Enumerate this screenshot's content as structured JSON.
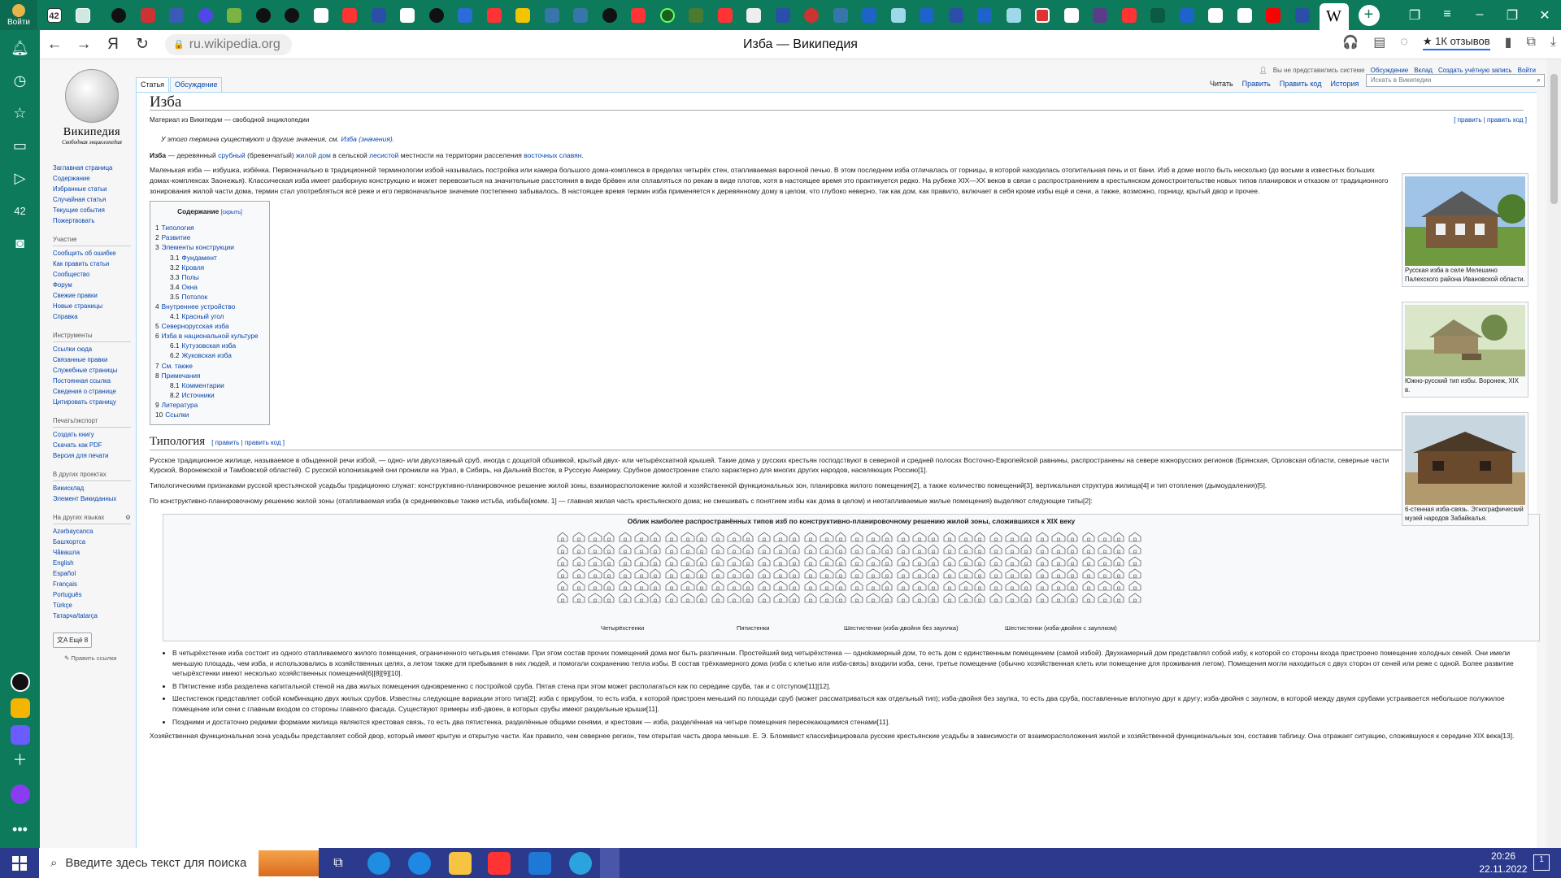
{
  "browser": {
    "login_label": "Войти",
    "tab_badge": "42",
    "wiki_tab_glyph": "W",
    "url": "ru.wikipedia.org",
    "page_title": "Изба — Википедия",
    "reviews": "★ 1К отзывов"
  },
  "wiki": {
    "logo_name": "Википедия",
    "logo_sub": "Свободная энциклопедия",
    "personal": [
      "Вы не представились системе",
      "Обсуждение",
      "Вклад",
      "Создать учётную запись",
      "Войти"
    ],
    "tabs_left": [
      "Статья",
      "Обсуждение"
    ],
    "tabs_right": [
      "Читать",
      "Править",
      "Править код",
      "История"
    ],
    "search_placeholder": "Искать в Википедии",
    "nav_main": [
      "Заглавная страница",
      "Содержание",
      "Избранные статьи",
      "Случайная статья",
      "Текущие события",
      "Пожертвовать"
    ],
    "nav_part_title": "Участие",
    "nav_part": [
      "Сообщить об ошибке",
      "Как править статьи",
      "Сообщество",
      "Форум",
      "Свежие правки",
      "Новые страницы",
      "Справка"
    ],
    "nav_tools_title": "Инструменты",
    "nav_tools": [
      "Ссылки сюда",
      "Связанные правки",
      "Служебные страницы",
      "Постоянная ссылка",
      "Сведения о странице",
      "Цитировать страницу"
    ],
    "nav_print_title": "Печать/экспорт",
    "nav_print": [
      "Создать книгу",
      "Скачать как PDF",
      "Версия для печати"
    ],
    "nav_proj_title": "В других проектах",
    "nav_proj": [
      "Викисклад",
      "Элемент Викиданных"
    ],
    "nav_lang_title": "На других языках",
    "nav_lang": [
      "Azərbaycanca",
      "Башҡортса",
      "Чӑвашла",
      "English",
      "Español",
      "Français",
      "Português",
      "Türkçe",
      "Татарча/tatarça"
    ],
    "more_langs": "文A Ещё 8",
    "edit_links": "✎ Править ссылки"
  },
  "article": {
    "title": "Изба",
    "subtitle": "Материал из Википедии — свободной энциклопедии",
    "edit_links": "[ править | править код ]",
    "hatnote_a": "У этого термина существуют и другие значения, см. ",
    "hatnote_link": "Изба (значения)",
    "lead1_a": "Изба",
    "lead1_b": " — деревянный ",
    "lead1_l1": "срубный",
    "lead1_c": " (бревенчатый) ",
    "lead1_l2": "жилой дом",
    "lead1_d": " в сельской ",
    "lead1_l3": "лесистой",
    "lead1_e": " местности на территории расселения ",
    "lead1_l4": "восточных славян",
    "lead2": "Маленькая изба — избушка, избёнка. Первоначально в традиционной терминологии избой называлась постройка или камера большого дома-комплекса в пределах четырёх стен, отапливаемая варочной печью. В этом последнем изба отличалась от горницы, в которой находилась отопительная печь и от бани. Изб в доме могло быть несколько (до восьми в известных больших домах-комплексах Заонежья). Классическая изба имеет разборную конструкцию и может перевозиться на значительные расстояния в виде брёвен или сплавляться по рекам в виде плотов, хотя в настоящее время это практикуется редко. На рубеже XIX—XX веков в связи с распространением в крестьянском домостроительстве новых типов планировок и отказом от традиционного зонирования жилой части дома, термин стал употребляться всё реже и его первоначальное значение постепенно забывалось. В настоящее время термин изба применяется к деревянному дому в целом, что глубоко неверно, так как дом, как правило, включает в себя кроме избы ещё и сени, а также, возможно, горницу, крытый двор и прочее.",
    "toc_title": "Содержание",
    "toc_hide": "[скрыть]",
    "toc": [
      {
        "n": "1",
        "t": "Типология",
        "lvl": 1
      },
      {
        "n": "2",
        "t": "Развитие",
        "lvl": 1
      },
      {
        "n": "3",
        "t": "Элементы конструкции",
        "lvl": 1
      },
      {
        "n": "3.1",
        "t": "Фундамент",
        "lvl": 2
      },
      {
        "n": "3.2",
        "t": "Кровля",
        "lvl": 2
      },
      {
        "n": "3.3",
        "t": "Полы",
        "lvl": 2
      },
      {
        "n": "3.4",
        "t": "Окна",
        "lvl": 2
      },
      {
        "n": "3.5",
        "t": "Потолок",
        "lvl": 2
      },
      {
        "n": "4",
        "t": "Внутреннее устройство",
        "lvl": 1
      },
      {
        "n": "4.1",
        "t": "Красный угол",
        "lvl": 2
      },
      {
        "n": "5",
        "t": "Севернорусская изба",
        "lvl": 1
      },
      {
        "n": "6",
        "t": "Изба в национальной культуре",
        "lvl": 1
      },
      {
        "n": "6.1",
        "t": "Кутузовская изба",
        "lvl": 2
      },
      {
        "n": "6.2",
        "t": "Жуковская изба",
        "lvl": 2
      },
      {
        "n": "7",
        "t": "См. также",
        "lvl": 1
      },
      {
        "n": "8",
        "t": "Примечания",
        "lvl": 1
      },
      {
        "n": "8.1",
        "t": "Комментарии",
        "lvl": 2
      },
      {
        "n": "8.2",
        "t": "Источники",
        "lvl": 2
      },
      {
        "n": "9",
        "t": "Литература",
        "lvl": 1
      },
      {
        "n": "10",
        "t": "Ссылки",
        "lvl": 1
      }
    ],
    "sec_typology": "Типология",
    "sec_edit": "[ править | править код ]",
    "typ_p1": "Русское традиционное жилище, называемое в обыденной речи избой, — одно- или двухэтажный сруб, иногда с дощатой обшивкой, крытый двух- или четырёхскатной крышей. Такие дома у русских крестьян господствуют в северной и средней полосах Восточно-Европейской равнины, распространены на севере южнорусских регионов (Брянская, Орловская области, северные части Курской, Воронежской и Тамбовской областей). С русской колонизацией они проникли на Урал, в Сибирь, на Дальний Восток, в Русскую Америку. Срубное домостроение стало характерно для многих других народов, населяющих Россию[1].",
    "typ_p2": "Типологическими признаками русской крестьянской усадьбы традиционно служат: конструктивно-планировочное решение жилой зоны, взаиморасположение жилой и хозяйственной функциональных зон, планировка жилого помещения[2], а также количество помещений[3], вертикальная структура жилища[4] и тип отопления (дымоудаления)[5].",
    "typ_p3": "По конструктивно-планировочному решению жилой зоны (отапливаемая изба (в средневековье также истьба, избьба[комм. 1] — главная жилая часть крестьянского дома; не смешивать с понятием избы как дома в целом) и неотапливаемые жилые помещения) выделяют следующие типы[2]:",
    "figure_title": "Облик наиболее распространённых типов изб по конструктивно-планировочному решению жилой зоны, сложившихся к XIX веку",
    "figure_labels": [
      "Четырёхстенки",
      "Пятистенки",
      "Шестистенки (изба-двойня без зауллка)",
      "Шестистенки (изба-двойня с зауллком)"
    ],
    "bullets": [
      "В четырёхстенке изба состоит из одного отапливаемого жилого помещения, ограниченного четырьмя стенами. При этом состав прочих помещений дома мог быть различным. Простейший вид четырёхстенка — одноkамерный дом, то есть дом с единственным помещением (самой избой). Двухкамерный дом представлял собой избу, к которой со стороны входа пристроено помещение холодных сеней. Они имели меньшую площадь, чем изба, и использовались в хозяйственных целях, а летом также для пребывания в них людей, и помогали сохранению тепла избы. В состав трёхкамерного дома (изба с клетью или изба-связь) входили изба, сени, третье помещение (обычно хозяйственная клеть или помещение для проживания летом). Помещения могли находиться с двух сторон от сеней или реже с одной. Более развитие четырёхстенки имеют несколько хозяйственных помещений[6][8][9][10].",
      "В Пятистенке изба разделена капитальной стеной на два жилых помещения одновременно с постройкой сруба. Пятая стена при этом может располагаться как по середине сруба, так и с отступом[11][12].",
      "Шестистенок представляет собой комбинацию двух жилых срубов. Известны следующие вариации этого типа[2]: изба с прирубом, то есть изба, к которой пристроен меньший по площади сруб (может рассматриваться как отдельный тип); изба-двойня без заулка, то есть два сруба, поставленные вплотную друг к другу; изба-двойня с заулком, в которой между двумя срубами устраивается небольшое полужилое помещение или сени с главным входом со стороны главного фасада. Существуют примеры изб-двоен, в которых срубы имеют раздельные крыши[11].",
      "Поздними и достаточно редкими формами жилища являются крестовая связь, то есть два пятистенка, разделённые общими сенями, и крестовик — изба, разделённая на четыре помещения пересекающимися стенами[11]."
    ],
    "typ_p4": "Хозяйственная функциональная зона усадьбы представляет собой двор, который имеет крытую и открытую части. Как правило, чем севернее регион, тем открытая часть двора меньше. Е. Э. Бломквист классифицировала русские крестьянские усадьбы в зависимости от взаиморасположения жилой и хозяйственной функциональных зон, составив таблицу. Она отражает ситуацию, сложившуюся к середине XIX века[13].",
    "captions": [
      "Русская изба в селе Мелешино Палехского района Ивановской области.",
      "Южно-русский тип избы. Воронеж, XIX в.",
      "6-стенная изба-связь. Этнографический музей народов Забайкалья."
    ]
  },
  "taskbar": {
    "search_placeholder": "Введите здесь текст для поиска",
    "time": "20:26",
    "date": "22.11.2022",
    "notif": "1"
  },
  "colors": {
    "browser_green": "#0e7a5c",
    "link": "#0645ad",
    "redlink": "#ba0000",
    "taskbar": "#2b3a8c"
  }
}
